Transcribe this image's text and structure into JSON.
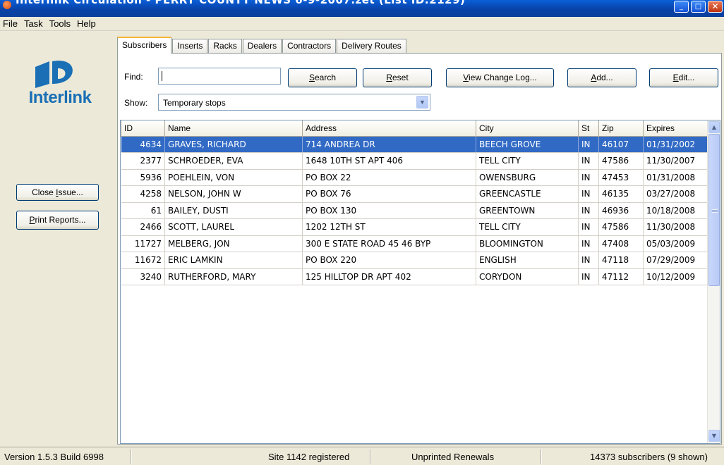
{
  "window": {
    "title": "Interlink Circulation - PERRY COUNTY NEWS 6-9-2007.zet (List ID:2129)",
    "minimize_glyph": "_",
    "maximize_glyph": "□",
    "close_glyph": "✕"
  },
  "menu": [
    "File",
    "Task",
    "Tools",
    "Help"
  ],
  "logo": {
    "text": "Interlink",
    "color": "#1a6fb5"
  },
  "sidebar": {
    "close_issue": "Close Issue...",
    "print_reports": "Print Reports..."
  },
  "tabs": [
    "Subscribers",
    "Inserts",
    "Racks",
    "Dealers",
    "Contractors",
    "Delivery Routes"
  ],
  "active_tab": "Subscribers",
  "search": {
    "find_label": "Find:",
    "find_value": "",
    "show_label": "Show:",
    "show_value": "Temporary stops",
    "search_button": "Search",
    "reset_button": "Reset",
    "change_log_button": "View Change Log...",
    "add_button": "Add...",
    "edit_button": "Edit..."
  },
  "table": {
    "columns": [
      "ID",
      "Name",
      "Address",
      "City",
      "St",
      "Zip",
      "Expires"
    ],
    "rows": [
      [
        "4634",
        "GRAVES, RICHARD",
        "714 ANDREA DR",
        "BEECH GROVE",
        "IN",
        "46107",
        "01/31/2002"
      ],
      [
        "2377",
        "SCHROEDER, EVA",
        "1648 10TH ST APT 406",
        "TELL CITY",
        "IN",
        "47586",
        "11/30/2007"
      ],
      [
        "5936",
        "POEHLEIN, VON",
        "PO BOX 22",
        "OWENSBURG",
        "IN",
        "47453",
        "01/31/2008"
      ],
      [
        "4258",
        "NELSON, JOHN W",
        "PO BOX 76",
        "GREENCASTLE",
        "IN",
        "46135",
        "03/27/2008"
      ],
      [
        "61",
        "BAILEY, DUSTI",
        "PO BOX 130",
        "GREENTOWN",
        "IN",
        "46936",
        "10/18/2008"
      ],
      [
        "2466",
        "SCOTT, LAUREL",
        "1202 12TH ST",
        "TELL CITY",
        "IN",
        "47586",
        "11/30/2008"
      ],
      [
        "11727",
        "MELBERG, JON",
        "300 E STATE ROAD 45 46 BYP",
        "BLOOMINGTON",
        "IN",
        "47408",
        "05/03/2009"
      ],
      [
        "11672",
        "ERIC LAMKIN",
        "PO BOX 220",
        "ENGLISH",
        "IN",
        "47118",
        "07/29/2009"
      ],
      [
        "3240",
        "RUTHERFORD, MARY",
        "125 HILLTOP DR APT 402",
        "CORYDON",
        "IN",
        "47112",
        "10/12/2009"
      ]
    ],
    "selected_row": 0,
    "selection_color": "#316ac5"
  },
  "status": {
    "version": "Version 1.5.3 Build 6998",
    "site": "Site 1142 registered",
    "renewals": "Unprinted Renewals",
    "count": "14373 subscribers (9 shown)"
  },
  "icons": {
    "dropdown": "chevron-down-icon",
    "scroll_up": "arrow-up-icon",
    "scroll_down": "arrow-down-icon",
    "up_glyph": "▲",
    "down_glyph": "▼"
  }
}
